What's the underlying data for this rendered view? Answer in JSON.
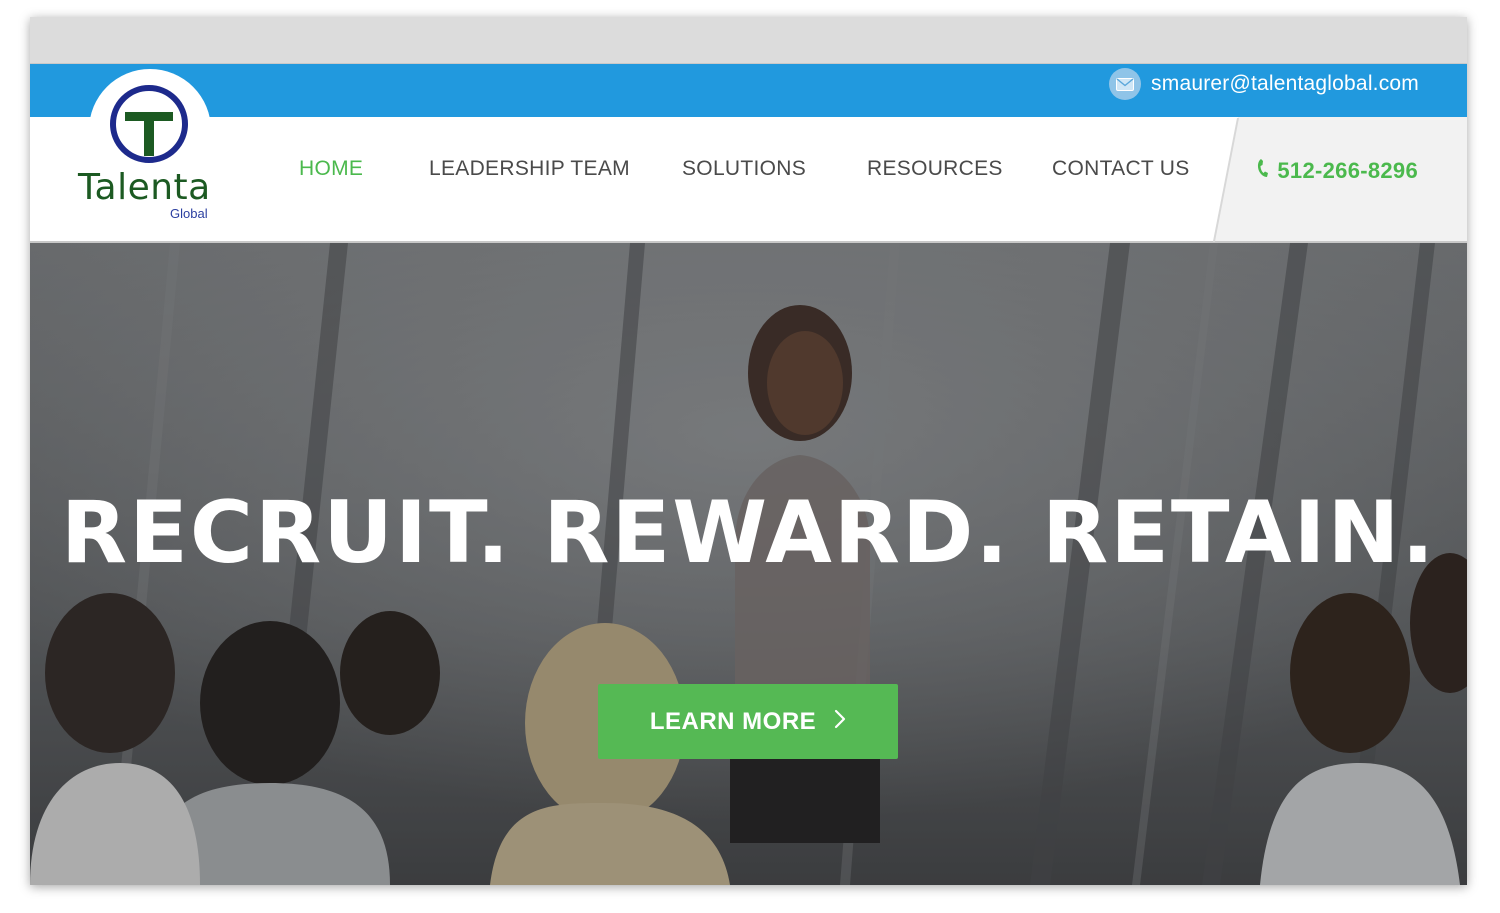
{
  "topbar": {
    "email": "smaurer@talentaglobal.com",
    "email_icon": "envelope-icon",
    "bg_color": "#2199de"
  },
  "logo": {
    "name": "Talenta",
    "sub": "Global"
  },
  "nav": {
    "items": [
      {
        "label": "HOME",
        "active": true
      },
      {
        "label": "LEADERSHIP TEAM",
        "active": false
      },
      {
        "label": "SOLUTIONS",
        "active": false
      },
      {
        "label": "RESOURCES",
        "active": false
      },
      {
        "label": "CONTACT US",
        "active": false
      }
    ],
    "active_color": "#4bb94d"
  },
  "phone": {
    "number": "512-266-8296",
    "icon": "phone-icon"
  },
  "hero": {
    "headline": "RECRUIT. REWARD. RETAIN.",
    "cta_label": "LEARN MORE",
    "cta_icon": "chevron-right-icon",
    "cta_color": "#55b954"
  }
}
